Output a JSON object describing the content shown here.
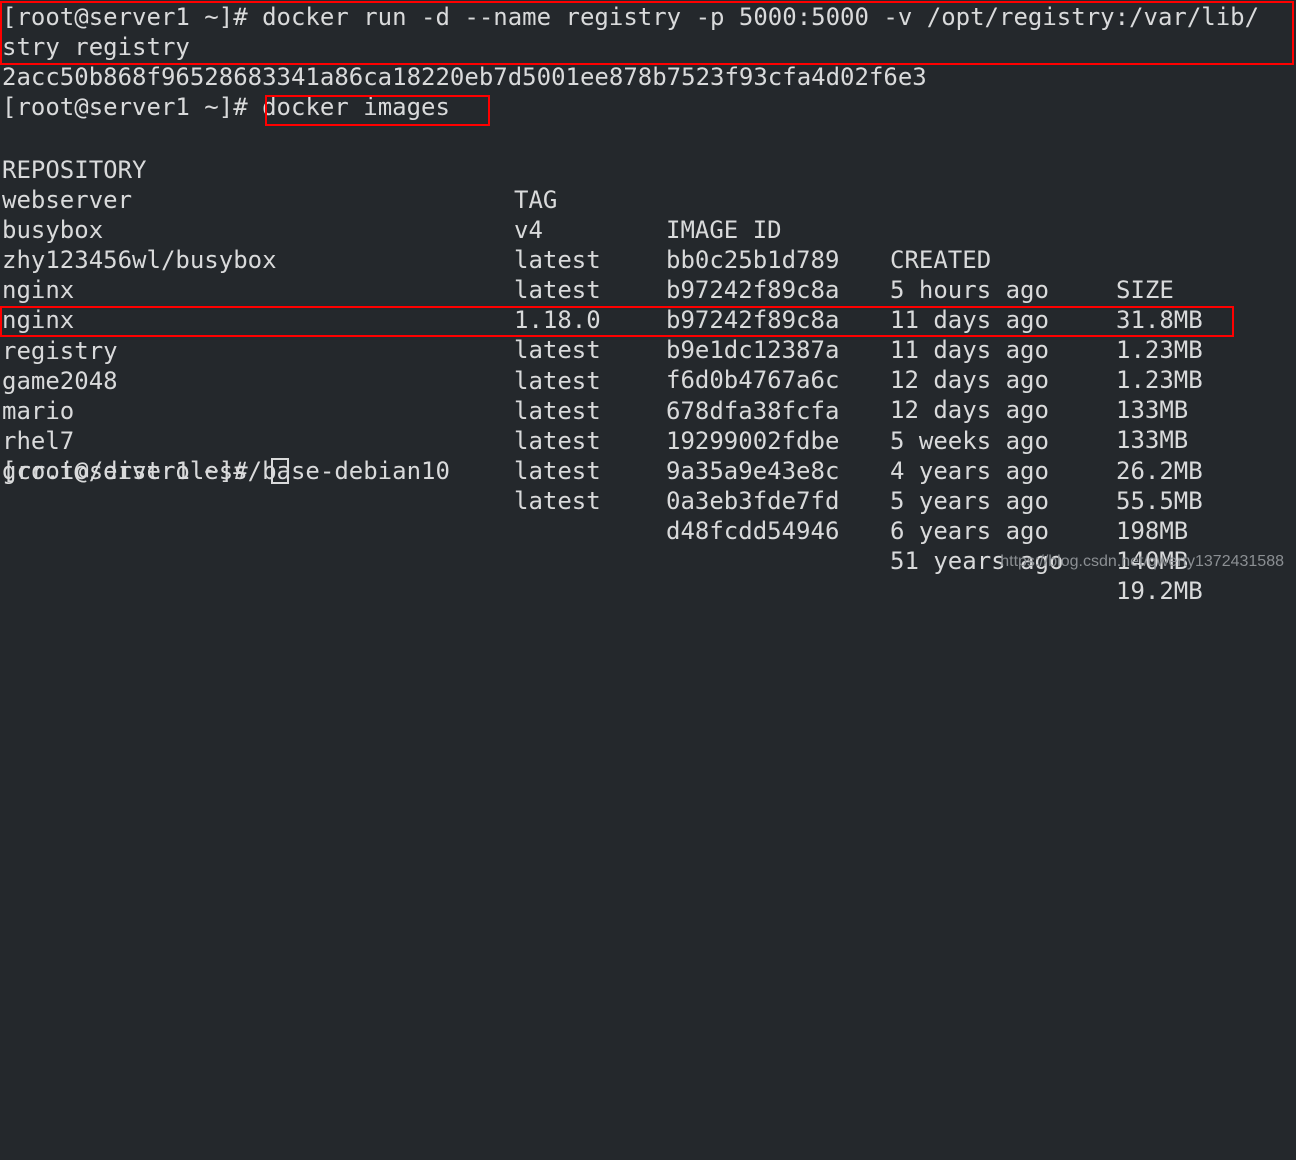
{
  "terminal": {
    "background_color": "#24282c",
    "foreground_color": "#d9dadb",
    "highlight_color": "#ff0000",
    "prompt": "[root@server1 ~]#",
    "command_run_line1": "[root@server1 ~]# docker run -d --name registry -p 5000:5000 -v /opt/registry:/var/lib/",
    "command_run_line2": "stry registry",
    "container_id": "2acc50b868f96528683341a86ca18220eb7d5001ee878b7523f93cfa4d02f6e3",
    "prompt_images": "[root@server1 ~]# ",
    "command_images": "docker images",
    "final_prompt": "[root@server1 ~]# "
  },
  "table": {
    "headers": {
      "repository": "REPOSITORY",
      "tag": "TAG",
      "image_id": "IMAGE ID",
      "created": "CREATED",
      "size": "SIZE"
    },
    "rows": [
      {
        "repository": "webserver",
        "tag": "v4",
        "image_id": "bb0c25b1d789",
        "created": "5 hours ago",
        "size": "31.8MB",
        "highlighted": false
      },
      {
        "repository": "busybox",
        "tag": "latest",
        "image_id": "b97242f89c8a",
        "created": "11 days ago",
        "size": "1.23MB",
        "highlighted": false
      },
      {
        "repository": "zhy123456wl/busybox",
        "tag": "latest",
        "image_id": "b97242f89c8a",
        "created": "11 days ago",
        "size": "1.23MB",
        "highlighted": false
      },
      {
        "repository": "nginx",
        "tag": "1.18.0",
        "image_id": "b9e1dc12387a",
        "created": "12 days ago",
        "size": "133MB",
        "highlighted": false
      },
      {
        "repository": "nginx",
        "tag": "latest",
        "image_id": "f6d0b4767a6c",
        "created": "12 days ago",
        "size": "133MB",
        "highlighted": false
      },
      {
        "repository": "registry",
        "tag": "latest",
        "image_id": "678dfa38fcfa",
        "created": "5 weeks ago",
        "size": "26.2MB",
        "highlighted": true
      },
      {
        "repository": "game2048",
        "tag": "latest",
        "image_id": "19299002fdbe",
        "created": "4 years ago",
        "size": "55.5MB",
        "highlighted": false
      },
      {
        "repository": "mario",
        "tag": "latest",
        "image_id": "9a35a9e43e8c",
        "created": "5 years ago",
        "size": "198MB",
        "highlighted": false
      },
      {
        "repository": "rhel7",
        "tag": "latest",
        "image_id": "0a3eb3fde7fd",
        "created": "6 years ago",
        "size": "140MB",
        "highlighted": false
      },
      {
        "repository": "gcr.io/distroless/base-debian10",
        "tag": "latest",
        "image_id": "d48fcdd54946",
        "created": "51 years ago",
        "size": "19.2MB",
        "highlighted": false
      }
    ]
  },
  "watermark": {
    "text": "https://blog.csdn.net/qwerty1372431588"
  }
}
